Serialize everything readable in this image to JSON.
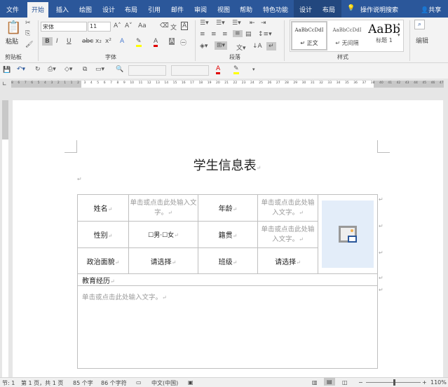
{
  "tabs": [
    "文件",
    "开始",
    "插入",
    "绘图",
    "设计",
    "布局",
    "引用",
    "邮件",
    "审阅",
    "视图",
    "帮助",
    "特色功能"
  ],
  "context_tabs": [
    "设计",
    "布局"
  ],
  "search": "操作说明搜索",
  "share": "共享",
  "ribbon": {
    "clipboard": {
      "paste": "粘贴",
      "label": "剪贴板"
    },
    "font": {
      "name": "宋体",
      "size": "11",
      "label": "字体",
      "aa": "Aa"
    },
    "paragraph": {
      "label": "段落"
    },
    "styles": {
      "label": "样式",
      "items": [
        {
          "preview": "AaBbCcDdI",
          "name": "正文"
        },
        {
          "preview": "AaBbCcDdI",
          "name": "无间隔"
        },
        {
          "preview": "AaBb",
          "name": "标题 1"
        }
      ]
    },
    "editing": {
      "label": "编辑"
    }
  },
  "ruler_numbers": [
    "8",
    "6",
    "7",
    "6",
    "5",
    "4",
    "3",
    "2",
    "1",
    "1",
    "2",
    "3",
    "4",
    "5",
    "6",
    "7",
    "8",
    "9",
    "10",
    "11",
    "12",
    "13",
    "14",
    "15",
    "16",
    "17",
    "18",
    "19",
    "20",
    "21",
    "22",
    "23",
    "24",
    "25",
    "26",
    "27",
    "28",
    "29",
    "30",
    "31",
    "32",
    "33",
    "34",
    "35",
    "36",
    "37",
    "38",
    "40",
    "41",
    "42",
    "43",
    "44",
    "45",
    "46",
    "47"
  ],
  "document": {
    "title": "学生信息表",
    "table": {
      "name_label": "姓名",
      "placeholder": "单击或点击此处输入文字。",
      "age_label": "年龄",
      "gender_label": "性别",
      "male": "男",
      "female": "女",
      "origin_label": "籍贯",
      "politics_label": "政治面貌",
      "select": "请选择",
      "class_label": "班级",
      "education_label": "教育经历"
    }
  },
  "status": {
    "section": "节: 1",
    "page": "第 1 页，共 1 页",
    "words": "85 个字",
    "chars": "86 个字符",
    "language": "中文(中国)",
    "zoom": "110%",
    "zoom_level": 110
  },
  "colors": {
    "brand": "#2b579a",
    "photo_bg": "#e3edf9",
    "font_color": "#e00000",
    "highlight": "#ffff00"
  }
}
